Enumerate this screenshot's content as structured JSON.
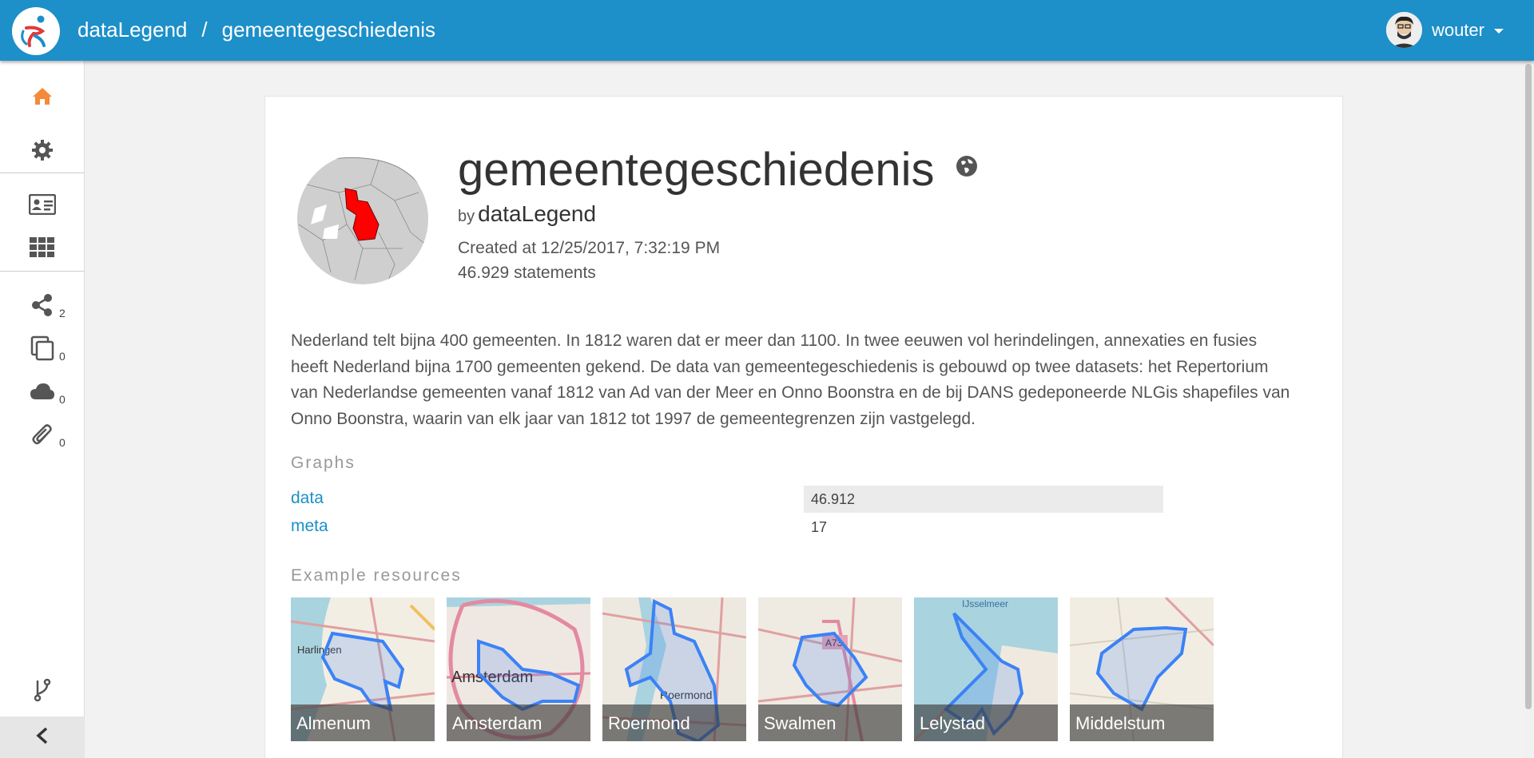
{
  "header": {
    "org": "dataLegend",
    "separator": "/",
    "dataset": "gemeentegeschiedenis",
    "user": "wouter"
  },
  "sidebar": {
    "items": [
      {
        "name": "home-icon",
        "count": ""
      },
      {
        "name": "gear-icon",
        "count": ""
      },
      {
        "name": "id-card-icon",
        "count": ""
      },
      {
        "name": "grid-icon",
        "count": ""
      },
      {
        "name": "share-icon",
        "count": "2"
      },
      {
        "name": "copy-icon",
        "count": "0"
      },
      {
        "name": "cloud-icon",
        "count": "0"
      },
      {
        "name": "paperclip-icon",
        "count": "0"
      }
    ]
  },
  "dataset": {
    "title": "gemeentegeschiedenis",
    "by_prefix": "by",
    "owner": "dataLegend",
    "created": "Created at 12/25/2017, 7:32:19 PM",
    "statements": "46.929 statements",
    "description": "Nederland telt bijna 400 gemeenten. In 1812 waren dat er meer dan 1100. In twee eeuwen vol herindelingen, annexaties en fusies heeft Nederland bijna 1700 gemeenten gekend. De data van gemeentegeschiedenis is gebouwd op twee datasets: het Repertorium van Nederlandse gemeenten vanaf 1812 van Ad van der Meer en Onno Boonstra en de bij DANS gedeponeerde NLGis shapefiles van Onno Boonstra, waarin van elk jaar van 1812 tot 1997 de gemeentegrenzen zijn vastgelegd."
  },
  "graphs": {
    "heading": "Graphs",
    "rows": [
      {
        "name": "data",
        "count": "46.912"
      },
      {
        "name": "meta",
        "count": "17"
      }
    ]
  },
  "examples": {
    "heading": "Example resources",
    "items": [
      {
        "label": "Almenum",
        "map_text": "Harlingen"
      },
      {
        "label": "Amsterdam",
        "map_text": "Amsterdam"
      },
      {
        "label": "Roermond",
        "map_text": "Roermond"
      },
      {
        "label": "Swalmen",
        "map_text": "A73"
      },
      {
        "label": "Lelystad",
        "map_text": "IJsselmeer"
      },
      {
        "label": "Middelstum",
        "map_text": ""
      }
    ]
  },
  "colors": {
    "brand": "#1d8fc9",
    "home_icon": "#f58a3a",
    "highlight_region": "#ff0000",
    "boundary": "#3b82f6"
  }
}
